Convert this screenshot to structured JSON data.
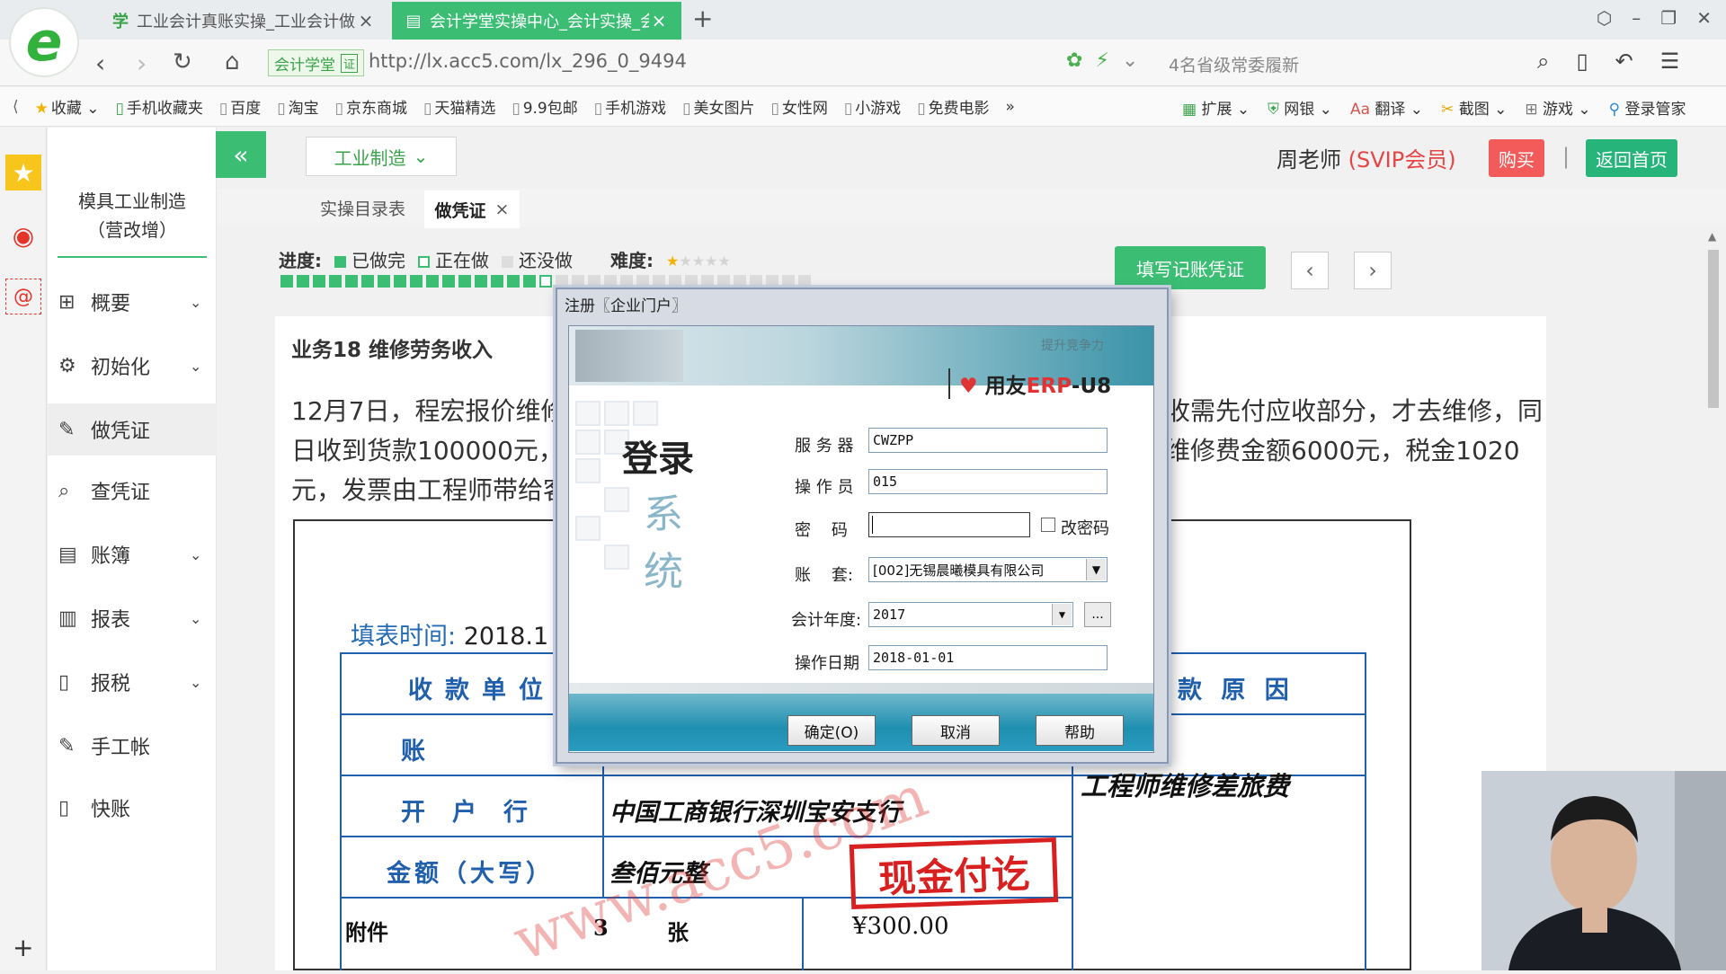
{
  "browser": {
    "tabs": [
      {
        "label": "工业会计真账实操_工业会计做账",
        "icon": "graduation-cap-icon"
      },
      {
        "label": "会计学堂实操中心_会计实操_会",
        "icon": "document-icon"
      }
    ],
    "site_badge": "会计学堂",
    "site_badge_mark": "证",
    "url": "http://lx.acc5.com/lx_296_0_9494",
    "hot_search": "4名省级常委履新",
    "bookmarks": [
      "收藏",
      "手机收藏夹",
      "百度",
      "淘宝",
      "京东商城",
      "天猫精选",
      "9.9包邮",
      "手机游戏",
      "美女图片",
      "女性网",
      "小游戏",
      "免费电影"
    ],
    "bookmarks_more": "»",
    "bookmark_tools": [
      "扩展",
      "网银",
      "翻译",
      "截图",
      "游戏",
      "登录管家"
    ]
  },
  "sidebar": {
    "company_line1": "模具工业制造",
    "company_line2": "（营改增）",
    "items": [
      {
        "label": "概要",
        "icon": "grid-icon",
        "expand": "⌄"
      },
      {
        "label": "初始化",
        "icon": "gear-icon",
        "expand": "⌄"
      },
      {
        "label": "做凭证",
        "icon": "pen-icon",
        "expand": ""
      },
      {
        "label": "查凭证",
        "icon": "search-icon",
        "expand": ""
      },
      {
        "label": "账簿",
        "icon": "book-icon",
        "expand": "⌄"
      },
      {
        "label": "报表",
        "icon": "report-icon",
        "expand": "⌄"
      },
      {
        "label": "报税",
        "icon": "file-icon",
        "expand": "⌄"
      },
      {
        "label": "手工帐",
        "icon": "pen-icon",
        "expand": ""
      },
      {
        "label": "快账",
        "icon": "file-icon",
        "expand": ""
      }
    ]
  },
  "header": {
    "collapse": "«",
    "industry": "工业制造",
    "teacher": "周老师",
    "vip": "(SVIP会员)",
    "buy": "购买",
    "separator": "|",
    "home": "返回首页"
  },
  "subtabs": {
    "catalog": "实操目录表",
    "voucher": "做凭证",
    "close": "×"
  },
  "progress": {
    "label": "进度:",
    "done": "已做完",
    "doing": "正在做",
    "todo": "还没做",
    "difficulty_label": "难度:",
    "difficulty": 1,
    "difficulty_max": 5,
    "done_count": 16,
    "doing_count": 1,
    "total": 33,
    "fill_button": "填写记账凭证",
    "prev": "‹",
    "next": "›"
  },
  "business": {
    "title": "业务18 维修劳务收入",
    "line1": "12月7日，程宏报价维修",
    "line1_right": "收需先付应收部分，才去维修，同",
    "line2": "日收到货款100000元，",
    "line2_right": "维修费金额6000元，税金1020",
    "line3": "元，发票由工程师带给客"
  },
  "voucher": {
    "fill_time_label": "填表时间:",
    "fill_time_value": "2018.1",
    "payee_label": "收款单位",
    "reason_label": "款 原 因",
    "account_label": "账 号",
    "bank_label": "开户行",
    "bank_value": "中国工商银行深圳宝安支行",
    "reason_value": "工程师维修差旅费",
    "amount_label": "金额（大写）",
    "amount_value": "叁佰元整",
    "attach_label": "附件",
    "attach_count": "3",
    "attach_unit": "张",
    "amount_number": "¥300.00",
    "stamp": "现金付讫",
    "watermark": "www.acc5.com"
  },
  "dialog": {
    "title": "注册〖企业门户〗",
    "slogan": "提升竞争力",
    "brand_prefix": "用友",
    "brand_erp": "ERP",
    "brand_suffix": "-U8",
    "big_text": "登录",
    "xi": "系",
    "tong": "统",
    "server_label": "服 务 器",
    "server_value": "CWZPP",
    "operator_label": "操 作 员",
    "operator_value": "015",
    "password_label": "密    码",
    "password_value": "",
    "change_pwd_label": "改密码",
    "account_label": "账    套:",
    "account_value": "[002]无锡晨曦模具有限公司",
    "year_label": "会计年度:",
    "year_value": "2017",
    "ellipsis": "...",
    "date_label": "操作日期",
    "date_value": "2018-01-01",
    "ok": "确定(O)",
    "cancel": "取消",
    "help": "帮助"
  },
  "colors": {
    "accent_green": "#3bbd74",
    "vip_red": "#e64545",
    "buy_red": "#f35a5a",
    "voucher_blue": "#1f5fab",
    "stamp_red": "#d92020"
  }
}
